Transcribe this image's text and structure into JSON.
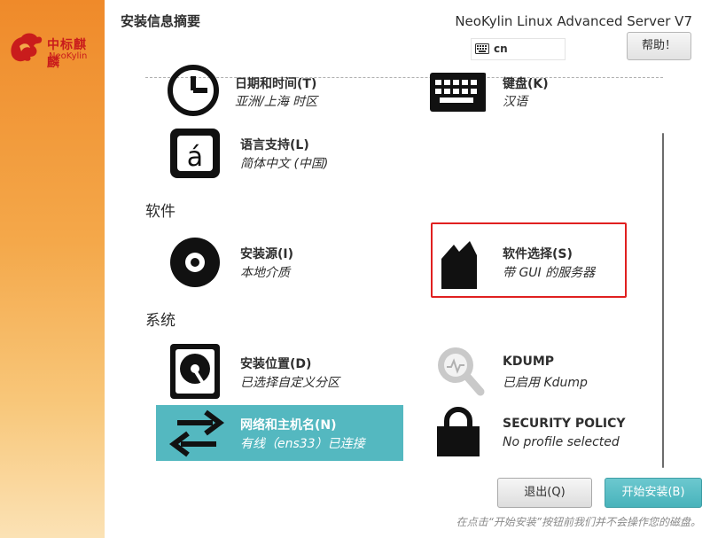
{
  "sidebar": {
    "logo_cn": "中标麒麟",
    "logo_en": "NeoKylin"
  },
  "header": {
    "title": "安装信息摘要",
    "product": "NeoKylin Linux Advanced Server V7",
    "keyboard_layout": "cn",
    "help_label": "帮助！"
  },
  "spokes": {
    "datetime": {
      "title": "日期和时间(T)",
      "status": "亚洲/上海 时区"
    },
    "keyboard": {
      "title": "键盘(K)",
      "status": "汉语"
    },
    "language": {
      "title": "语言支持(L)",
      "status": "简体中文 (中国)"
    },
    "source": {
      "title": "安装源(I)",
      "status": "本地介质"
    },
    "software": {
      "title": "软件选择(S)",
      "status": "带 GUI 的服务器"
    },
    "destination": {
      "title": "安装位置(D)",
      "status": "已选择自定义分区"
    },
    "kdump": {
      "title": "KDUMP",
      "status": "已启用 Kdump"
    },
    "network": {
      "title": "网络和主机名(N)",
      "status": "有线（ens33）已连接"
    },
    "security": {
      "title": "SECURITY POLICY",
      "status": "No profile selected"
    }
  },
  "sections": {
    "software": "软件",
    "system": "系统"
  },
  "footer": {
    "quit_label": "退出(Q)",
    "begin_label": "开始安装(B)",
    "note": "在点击“开始安装”按钮前我们并不会操作您的磁盘。"
  },
  "colors": {
    "accent": "#54b8c0",
    "highlight_border": "#e02020",
    "sidebar_top": "#ef8a2a",
    "sidebar_bottom": "#fbe2b5"
  }
}
